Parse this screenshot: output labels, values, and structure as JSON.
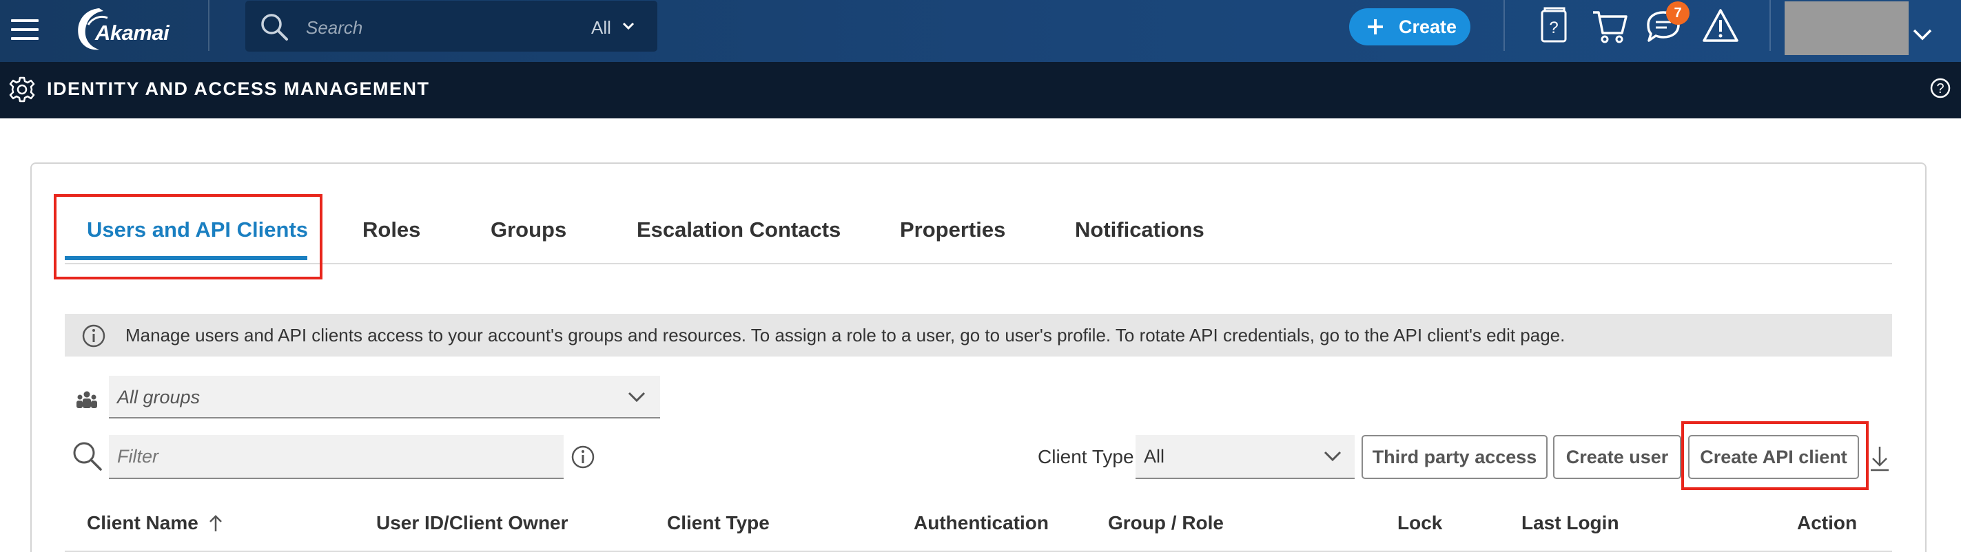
{
  "topbar": {
    "brand": "Akamai",
    "search": {
      "placeholder": "Search",
      "scope": "All"
    },
    "create_label": "Create",
    "notification_count": "7",
    "icons": [
      "menu-icon",
      "search-icon",
      "chevron-down-icon",
      "plus-icon",
      "help-book-icon",
      "cart-icon",
      "chat-icon",
      "alert-icon"
    ],
    "colors": {
      "bar": "#1a4578",
      "create_button": "#1a8fdd",
      "badge": "#f26a21"
    }
  },
  "section": {
    "title": "IDENTITY AND ACCESS MANAGEMENT"
  },
  "tabs": [
    {
      "label": "Users and API Clients",
      "active": true
    },
    {
      "label": "Roles",
      "active": false
    },
    {
      "label": "Groups",
      "active": false
    },
    {
      "label": "Escalation Contacts",
      "active": false
    },
    {
      "label": "Properties",
      "active": false
    },
    {
      "label": "Notifications",
      "active": false
    }
  ],
  "info_banner": {
    "text": "Manage users and API clients access to your account's groups and resources. To assign a role to a user, go to user's profile. To rotate API credentials, go to the API client's edit page."
  },
  "filters": {
    "groups_value": "All groups",
    "filter_placeholder": "Filter",
    "client_type_label": "Client Type",
    "client_type_value": "All"
  },
  "actions": {
    "third_party": "Third party access",
    "create_user": "Create user",
    "create_api_client": "Create API client"
  },
  "table": {
    "columns": [
      "Client Name",
      "User ID/Client Owner",
      "Client Type",
      "Authentication",
      "Group / Role",
      "Lock",
      "Last Login",
      "Action"
    ],
    "sorted_column": "Client Name",
    "sort_direction": "ascending"
  },
  "accent_colors": {
    "active_tab": "#1a7fc1",
    "highlight_box": "#e8261c"
  }
}
